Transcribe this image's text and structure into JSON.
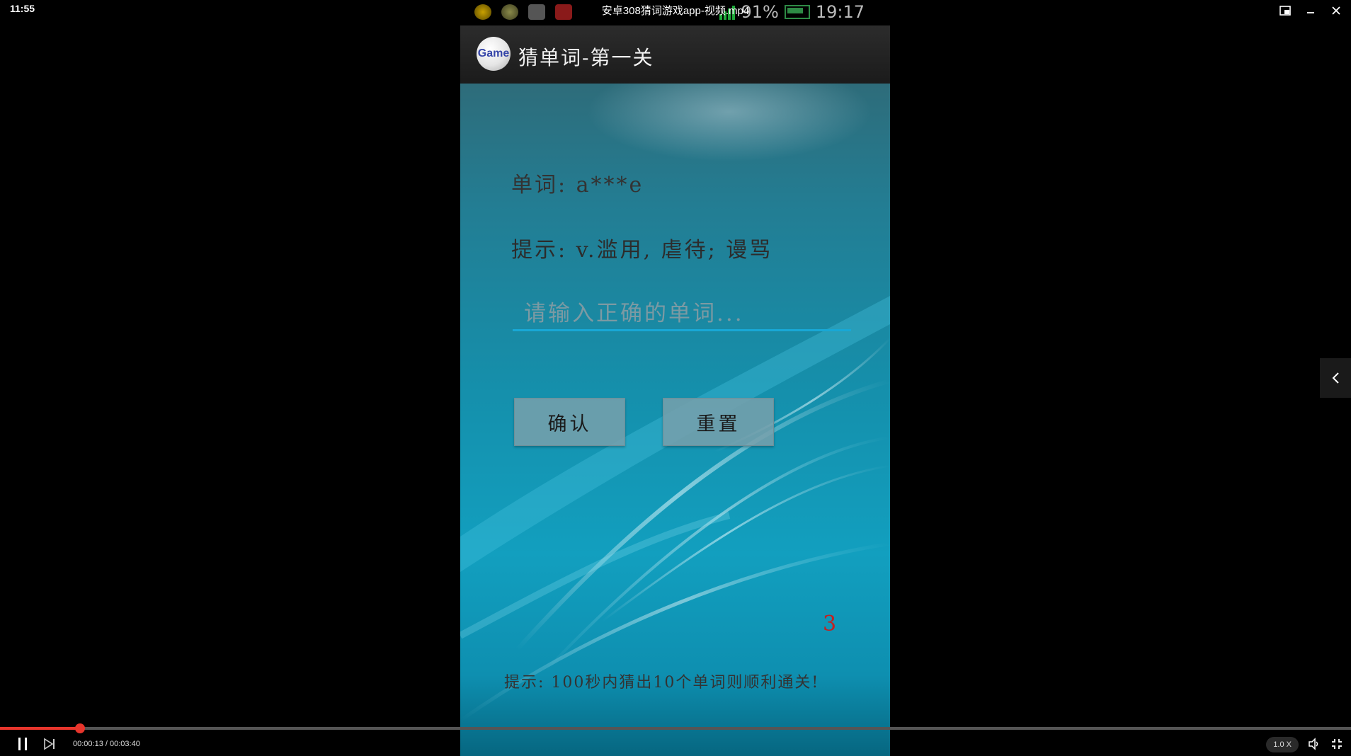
{
  "player": {
    "clock": "11:55",
    "video_title": "安卓308猜词游戏app-视频.mp4",
    "time_display": "00:00:13 / 00:03:40",
    "progress_fraction": 0.059,
    "speed": "1.0 X"
  },
  "phone_status": {
    "battery_percent": "91%",
    "time": "19:17"
  },
  "app": {
    "logo_text": "Game",
    "title": "猜单词-第一关",
    "word_line": "单词: a***e",
    "hint_line": "提示: v.滥用, 虐待; 谩骂",
    "input_placeholder": "请输入正确的单词...",
    "input_value": "",
    "confirm_label": "确认",
    "reset_label": "重置",
    "countdown": "3",
    "bottom_tip": "提示: 100秒内猜出10个单词则顺利通关!"
  },
  "colors": {
    "accent_progress": "#e8352c",
    "input_underline": "#18a8d6",
    "countdown": "#c42020"
  }
}
